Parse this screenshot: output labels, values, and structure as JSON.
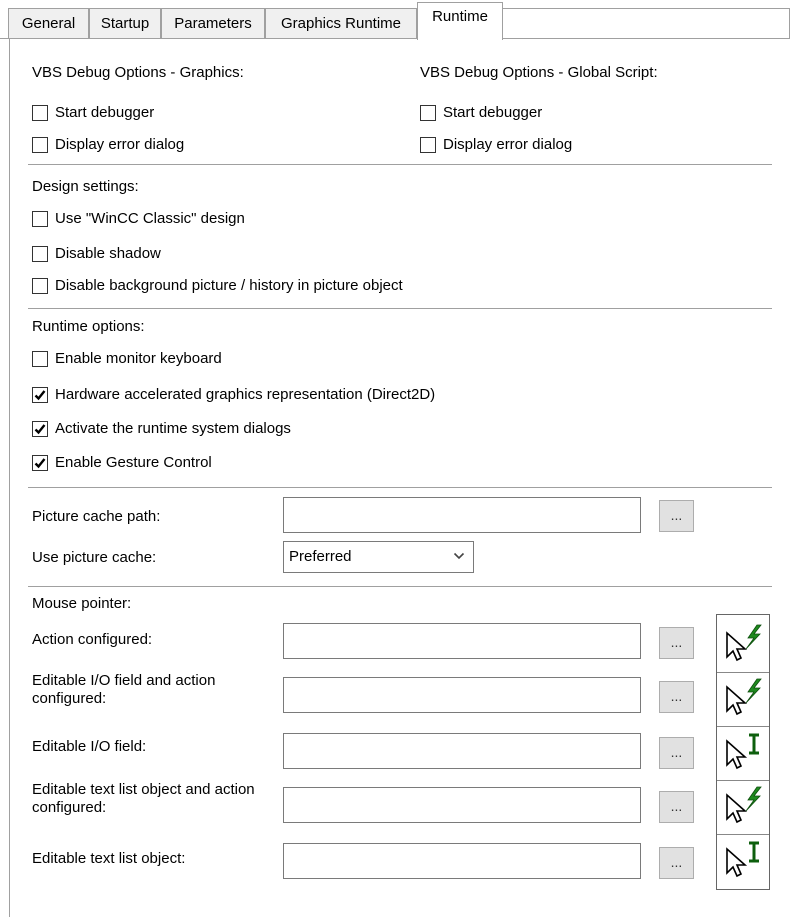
{
  "tabs": [
    {
      "label": "General"
    },
    {
      "label": "Startup"
    },
    {
      "label": "Parameters"
    },
    {
      "label": "Graphics Runtime"
    },
    {
      "label": "Runtime"
    }
  ],
  "vbs": {
    "graphics_heading": "VBS Debug Options - Graphics:",
    "global_heading": "VBS Debug Options - Global Script:",
    "graphics_start_debugger": {
      "label": "Start debugger",
      "checked": false
    },
    "graphics_display_error": {
      "label": "Display error dialog",
      "checked": false
    },
    "global_start_debugger": {
      "label": "Start debugger",
      "checked": false
    },
    "global_display_error": {
      "label": "Display error dialog",
      "checked": false
    }
  },
  "design": {
    "heading": "Design settings:",
    "classic": {
      "label": "Use \"WinCC Classic\" design",
      "checked": false
    },
    "shadow": {
      "label": "Disable shadow",
      "checked": false
    },
    "background": {
      "label": "Disable background picture / history in picture object",
      "checked": false
    }
  },
  "runtime": {
    "heading": "Runtime options:",
    "monitor_keyboard": {
      "label": "Enable monitor keyboard",
      "checked": false
    },
    "direct2d": {
      "label": "Hardware accelerated graphics representation (Direct2D)",
      "checked": true
    },
    "system_dialogs": {
      "label": "Activate the runtime system dialogs",
      "checked": true
    },
    "gesture": {
      "label": "Enable Gesture Control",
      "checked": true
    }
  },
  "cache": {
    "path_label": "Picture cache path:",
    "path_value": "",
    "use_label": "Use picture cache:",
    "use_value": "Preferred"
  },
  "mouse": {
    "heading": "Mouse pointer:",
    "browse_label": "...",
    "rows": [
      {
        "label": "Action configured:",
        "value": "",
        "pointer": "arrow-lightning-icon"
      },
      {
        "label": "Editable I/O field and action configured:",
        "value": "",
        "pointer": "arrow-lightning-icon"
      },
      {
        "label": "Editable I/O field:",
        "value": "",
        "pointer": "arrow-ibeam-icon"
      },
      {
        "label": "Editable text list object and action configured:",
        "value": "",
        "pointer": "arrow-lightning-icon"
      },
      {
        "label": "Editable text list object:",
        "value": "",
        "pointer": "arrow-ibeam-icon"
      }
    ]
  },
  "colors": {
    "accent_green": "#1f8a1f",
    "border": "#a0a0a0"
  }
}
